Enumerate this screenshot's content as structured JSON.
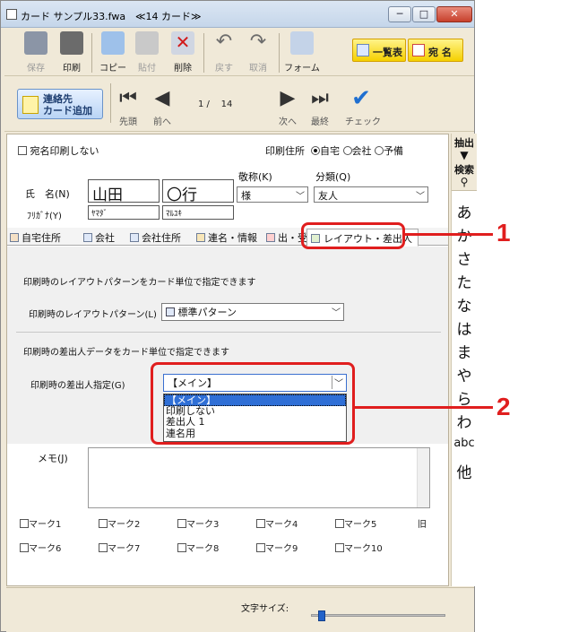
{
  "window": {
    "title": "カード サンプル33.fwa",
    "subtitle": "≪14 カード≫",
    "min": "─",
    "max": "□",
    "close": "✕"
  },
  "toolbar": {
    "save": "保存",
    "print": "印刷",
    "copy": "コピー",
    "paste": "貼付",
    "delete": "削除",
    "undo": "戻す",
    "cancel": "取消",
    "form": "フォーム",
    "list": "一覧表",
    "address": "宛 名"
  },
  "nav": {
    "add_card": [
      "連絡先",
      "カード追加"
    ],
    "first": "先頭",
    "prev": "前へ",
    "next": "次へ",
    "last": "最終",
    "check": "チェック",
    "current": "1",
    "total": "14"
  },
  "sidebar": {
    "extract": "抽出",
    "search": "検索",
    "kana": [
      "あ",
      "か",
      "さ",
      "た",
      "な",
      "は",
      "ま",
      "や",
      "ら",
      "わ",
      "abc",
      "他"
    ]
  },
  "form": {
    "no_print_label": "宛名印刷しない",
    "print_address_label": "印刷住所",
    "addr_options": [
      "自宅",
      "会社",
      "予備"
    ],
    "honorific_label": "敬称(K)",
    "honorific_value": "様",
    "category_label": "分類(Q)",
    "category_value": "友人",
    "name_label": "氏　名(N)",
    "family_name": "山田",
    "given_name": "〇行",
    "furigana_label": "ﾌﾘｶﾞﾅ(Y)",
    "family_kana": "ﾔﾏﾀﾞ",
    "given_kana": "ﾏﾙﾕｷ"
  },
  "tabs": [
    "自宅住所",
    "会社",
    "会社住所",
    "連名・情報",
    "出・受",
    "レイアウト・差出人"
  ],
  "panel": {
    "layout_desc": "印刷時のレイアウトパターンをカード単位で指定できます",
    "layout_label": "印刷時のレイアウトパターン(L)",
    "layout_value": "標準パターン",
    "sender_desc": "印刷時の差出人データをカード単位で指定できます",
    "sender_label": "印刷時の差出人指定(G)",
    "sender_value": "【メイン】",
    "sender_options": [
      "【メイン】",
      "印刷しない",
      "差出人 1",
      "連名用"
    ]
  },
  "memo": {
    "label": "メモ(J)"
  },
  "marks": [
    "マーク1",
    "マーク2",
    "マーク3",
    "マーク4",
    "マーク5",
    "マーク6",
    "マーク7",
    "マーク8",
    "マーク9",
    "マーク10"
  ],
  "marks_extra": "旧",
  "bottom": {
    "font_size_label": "文字サイズ:",
    "font_size_level": 0.05
  },
  "callouts": [
    "1",
    "2"
  ],
  "colors": {
    "callout": "#e01e1e",
    "selection": "#2f6fd6",
    "toolbar_bg": "#f0e9d8"
  }
}
